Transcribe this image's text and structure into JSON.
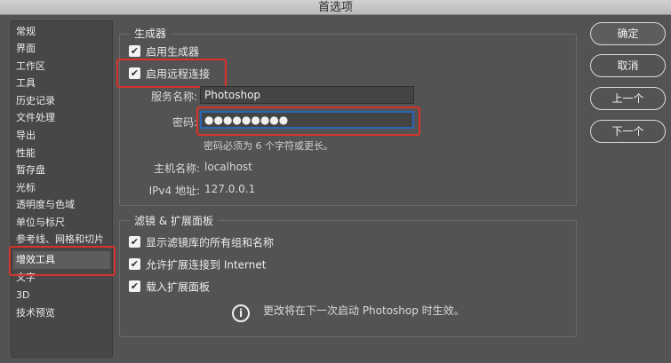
{
  "window": {
    "title": "首选项"
  },
  "sidebar": {
    "items": [
      {
        "label": "常规"
      },
      {
        "label": "界面"
      },
      {
        "label": "工作区"
      },
      {
        "label": "工具"
      },
      {
        "label": "历史记录"
      },
      {
        "label": "文件处理"
      },
      {
        "label": "导出"
      },
      {
        "label": "性能"
      },
      {
        "label": "暂存盘"
      },
      {
        "label": "光标"
      },
      {
        "label": "透明度与色域"
      },
      {
        "label": "单位与标尺"
      },
      {
        "label": "参考线、网格和切片"
      },
      {
        "label": "增效工具",
        "selected": true
      },
      {
        "label": "文字"
      },
      {
        "label": "3D"
      },
      {
        "label": "技术预览"
      }
    ]
  },
  "generator": {
    "title": "生成器",
    "enable_generator": {
      "label": "启用生成器",
      "checked": true
    },
    "enable_remote": {
      "label": "启用远程连接",
      "checked": true
    },
    "service_name": {
      "label": "服务名称:",
      "value": "Photoshop"
    },
    "password": {
      "label": "密码:",
      "value": "●●●●●●●●●"
    },
    "password_hint": "密码必须为 6 个字符或更长。",
    "host_name": {
      "label": "主机名称:",
      "value": "localhost"
    },
    "ipv4": {
      "label": "IPv4 地址:",
      "value": "127.0.0.1"
    }
  },
  "filters": {
    "title": "滤镜 & 扩展面板",
    "show_all_groups": {
      "label": "显示滤镜库的所有组和名称",
      "checked": true
    },
    "allow_internet": {
      "label": "允许扩展连接到 Internet",
      "checked": true
    },
    "load_extensions": {
      "label": "载入扩展面板",
      "checked": true
    },
    "notice": "更改将在下一次启动 Photoshop 时生效。"
  },
  "buttons": {
    "ok": "确定",
    "cancel": "取消",
    "prev": "上一个",
    "next": "下一个"
  },
  "icons": {
    "checkbox": "checkmark-icon",
    "info": "info-icon"
  },
  "colors": {
    "highlight_box": "#d8322a",
    "focus_ring": "#2a67b8",
    "panel_bg": "#535353"
  }
}
